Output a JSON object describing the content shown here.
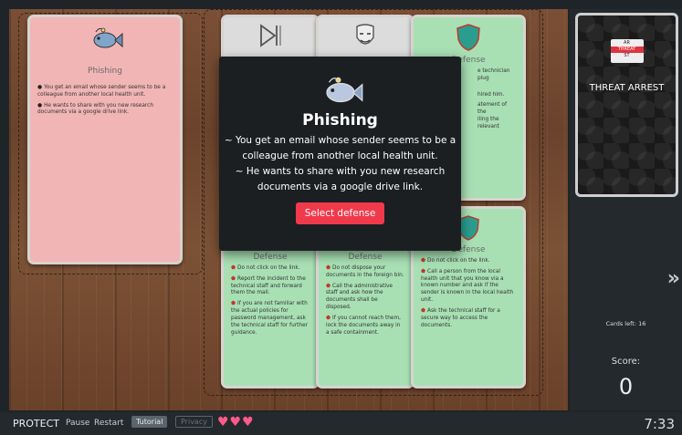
{
  "threat_card": {
    "title": "Phishing",
    "bullets": [
      "You get an email whose sender seems to be a colleague from another local health unit.",
      "He wants to share with you new research documents via a google drive link."
    ]
  },
  "upper_cards": {
    "card3_title": "Defense",
    "card3_lines": [
      "e technician plug",
      "hired him.",
      "atement of the",
      "lling the relevant"
    ]
  },
  "defense_cards": [
    {
      "title": "Defense",
      "items": [
        "Do not click on the link.",
        "Report the incident to the technical staff and forward them the mail.",
        "If you are not familiar with the actual policies for password management, ask the technical staff for further guidance."
      ]
    },
    {
      "title": "Defense",
      "items": [
        "Do not dispose your documents in the foreign bin.",
        "Call the administrative staff and ask how the documents shall be disposed.",
        "If you cannot reach them, lock the documents away in a safe containment."
      ]
    },
    {
      "title": "Defense",
      "items": [
        "Do not click on the link.",
        "Call a person from the local health unit that you know via a known number and ask if the sender is known in the local health unit.",
        "Ask the technical staff for a secure way to access the documents."
      ]
    }
  ],
  "modal": {
    "title": "Phishing",
    "lines": [
      "~ You get an email whose sender seems to be a",
      "colleague from another local health unit.",
      "~ He wants to share with you new research",
      "documents via a google drive link."
    ],
    "button": "Select defense"
  },
  "right_panel": {
    "deck_title": "THREAT ARREST",
    "logo_top": "AR",
    "logo_mid": "THREAT",
    "logo_bot": "ST",
    "next_icon": "chevron-right-double",
    "cards_left": "Cards left: 16",
    "score_label": "Score:",
    "score_value": "0"
  },
  "bottom_bar": {
    "brand": "PROTECT",
    "pause": "Pause",
    "restart": "Restart",
    "tutorial": "Tutorial",
    "privacy": "Privacy",
    "lives": "♥♥♥",
    "clock": "7:33"
  },
  "colors": {
    "threat_card": "#f1b5b5",
    "defense_card": "#a8e0b4",
    "button": "#f03a4b",
    "hearts": "#ff5a8a"
  }
}
